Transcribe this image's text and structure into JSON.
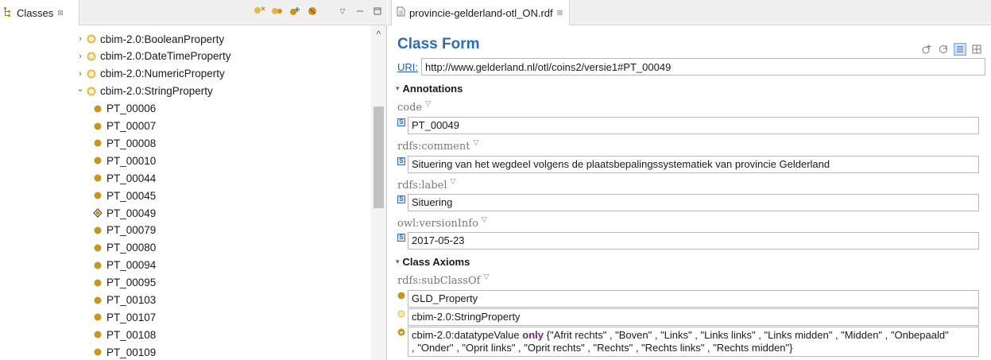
{
  "classes_view": {
    "tab_label": "Classes",
    "tab_close": "⊠",
    "toolbar_icons": [
      "class-hierarchy-icon",
      "property-icon",
      "instance-icon",
      "delete-icon",
      "view-menu-icon",
      "minimize-icon",
      "maximize-icon"
    ],
    "tree": [
      {
        "label": "cbim-2.0:BooleanProperty",
        "twisty": "›",
        "level": 0,
        "icon": "class"
      },
      {
        "label": "cbim-2.0:DateTimeProperty",
        "twisty": "›",
        "level": 0,
        "icon": "class"
      },
      {
        "label": "cbim-2.0:NumericProperty",
        "twisty": "›",
        "level": 0,
        "icon": "class"
      },
      {
        "label": "cbim-2.0:StringProperty",
        "twisty": "⌄",
        "level": 0,
        "icon": "class"
      },
      {
        "label": "PT_00006",
        "twisty": "",
        "level": 1,
        "icon": "individual"
      },
      {
        "label": "PT_00007",
        "twisty": "",
        "level": 1,
        "icon": "individual"
      },
      {
        "label": "PT_00008",
        "twisty": "",
        "level": 1,
        "icon": "individual"
      },
      {
        "label": "PT_00010",
        "twisty": "",
        "level": 1,
        "icon": "individual"
      },
      {
        "label": "PT_00044",
        "twisty": "",
        "level": 1,
        "icon": "individual"
      },
      {
        "label": "PT_00045",
        "twisty": "",
        "level": 1,
        "icon": "individual"
      },
      {
        "label": "PT_00049",
        "twisty": "",
        "level": 1,
        "icon": "selected"
      },
      {
        "label": "PT_00079",
        "twisty": "",
        "level": 1,
        "icon": "individual"
      },
      {
        "label": "PT_00080",
        "twisty": "",
        "level": 1,
        "icon": "individual"
      },
      {
        "label": "PT_00094",
        "twisty": "",
        "level": 1,
        "icon": "individual"
      },
      {
        "label": "PT_00095",
        "twisty": "",
        "level": 1,
        "icon": "individual"
      },
      {
        "label": "PT_00103",
        "twisty": "",
        "level": 1,
        "icon": "individual"
      },
      {
        "label": "PT_00107",
        "twisty": "",
        "level": 1,
        "icon": "individual"
      },
      {
        "label": "PT_00108",
        "twisty": "",
        "level": 1,
        "icon": "individual"
      },
      {
        "label": "PT_00109",
        "twisty": "",
        "level": 1,
        "icon": "individual"
      }
    ],
    "scroll_up": "^"
  },
  "editor": {
    "tab_label": "provincie-gelderland-otl_ON.rdf",
    "tab_close": "⊠",
    "form_title": "Class Form",
    "uri_link": "URI:",
    "uri_value": "http://www.gelderland.nl/otl/coins2/versie1#PT_00049",
    "sections": {
      "annotations": "Annotations",
      "class_axioms": "Class Axioms"
    },
    "annotations": {
      "code_label": "code",
      "code_value": "PT_00049",
      "comment_label": "rdfs:comment",
      "comment_value": "Situering van het wegdeel volgens de plaatsbepalingssystematiek van provincie Gelderland",
      "label_label": "rdfs:label",
      "label_value": "Situering",
      "version_label": "owl:versionInfo",
      "version_value": "2017-05-23"
    },
    "axioms": {
      "subclass_label": "rdfs:subClassOf",
      "values": [
        "GLD_Property",
        "cbim-2.0:StringProperty"
      ],
      "restriction_prop": "cbim-2.0:datatypeValue",
      "restriction_kw": "only",
      "restriction_line1": "{\"Afrit rechts\" , \"Boven\" , \"Links\" , \"Links links\" , \"Links midden\" , \"Midden\" , \"Onbepaald\"",
      "restriction_line2": ", \"Onder\" , \"Oprit links\" , \"Oprit rechts\" , \"Rechts\" , \"Rechts links\" , \"Rechts midden\"}"
    },
    "caret": "▽",
    "collapse": "▾",
    "s_badge": "S"
  },
  "colors": {
    "accent_blue": "#2a6fb3",
    "individual_dot": "#c8951e",
    "class_circle": "#e5b84a",
    "only_keyword": "#7a1f7a"
  }
}
